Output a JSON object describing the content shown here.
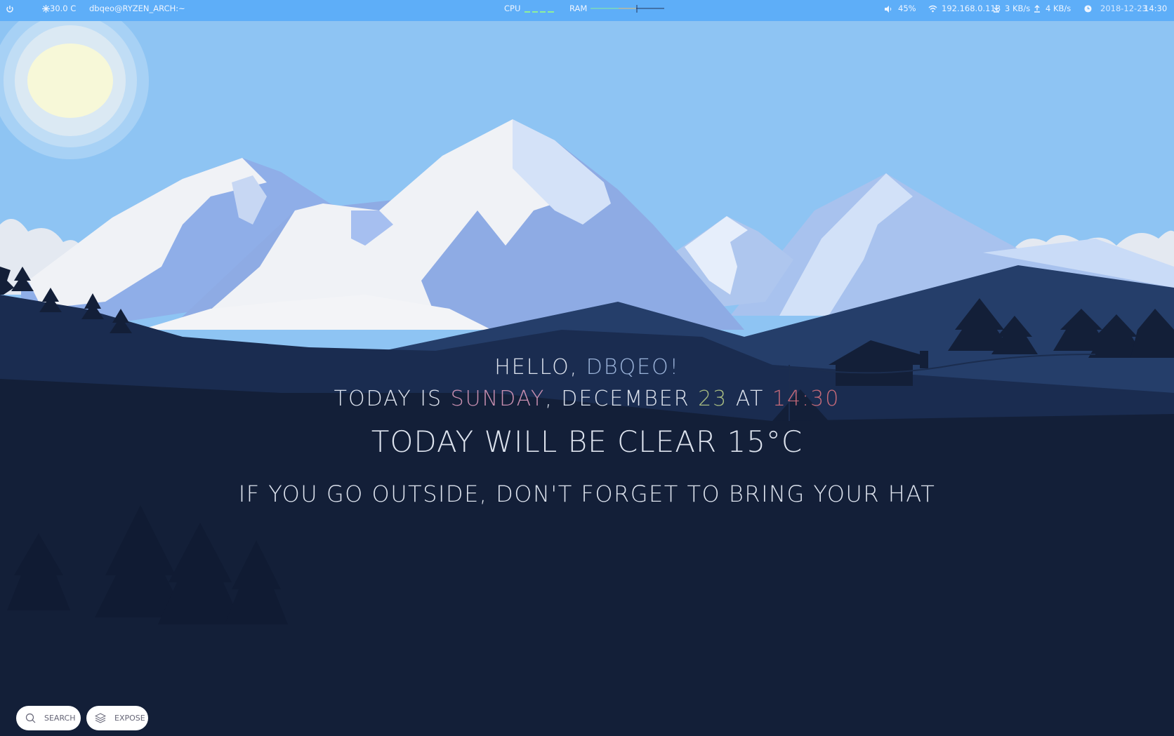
{
  "topbar": {
    "temperature": "30.0 C",
    "user_host": "dbqeo@RYZEN_ARCH:~",
    "cpu_label": "CPU",
    "ram_label": "RAM",
    "volume": "45%",
    "ip": "192.168.0.113",
    "download": "3 KB/s",
    "upload": "4 KB/s",
    "date": "2018-12-23",
    "time": "14:30"
  },
  "greeting": {
    "hello_prefix": "HELLO, ",
    "username": "DBQEO!",
    "today_is": "TODAY IS ",
    "day": "SUNDAY",
    "month_text": ", DECEMBER ",
    "day_number": "23",
    "at": " AT ",
    "time": "14:30",
    "weather": "TODAY WILL BE CLEAR 15°C",
    "advice": "IF YOU GO OUTSIDE, DON'T FORGET TO BRING YOUR HAT"
  },
  "buttons": {
    "search": "SEARCH",
    "expose": "EXPOSE"
  },
  "colors": {
    "bar": "#5eaef8",
    "sky": "#8ec4f3",
    "foreground": "#111e35",
    "accent_name": "#9bb3d9",
    "accent_day": "#c98fb0",
    "accent_number": "#a9bd82",
    "accent_time": "#c56a79"
  }
}
